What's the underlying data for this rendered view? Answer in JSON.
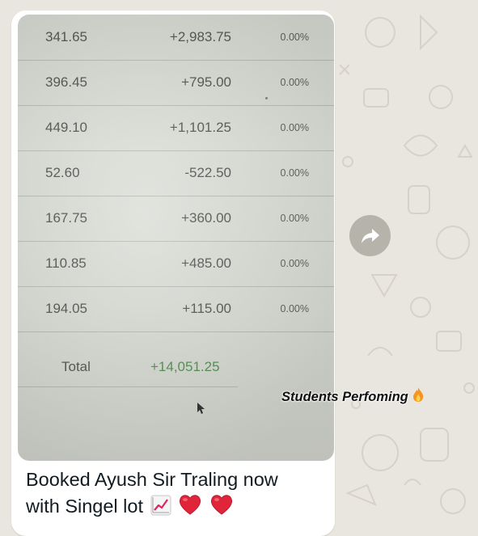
{
  "photo": {
    "rows": [
      {
        "price": "341.65",
        "pnl": "+2,983.75",
        "pct": "0.00%"
      },
      {
        "price": "396.45",
        "pnl": "+795.00",
        "pct": "0.00%"
      },
      {
        "price": "449.10",
        "pnl": "+1,101.25",
        "pct": "0.00%"
      },
      {
        "price": "52.60",
        "pnl": "-522.50",
        "pct": "0.00%"
      },
      {
        "price": "167.75",
        "pnl": "+360.00",
        "pct": "0.00%"
      },
      {
        "price": "110.85",
        "pnl": "+485.00",
        "pct": "0.00%"
      },
      {
        "price": "194.05",
        "pnl": "+115.00",
        "pct": "0.00%"
      }
    ],
    "total_label": "Total",
    "total_value": "+14,051.25"
  },
  "message": {
    "caption_line1": "Booked Ayush Sir Traling now",
    "caption_line2": "with Singel lot"
  },
  "sticker": {
    "text": "Students Perfoming"
  },
  "icons": {
    "forward": "forward-arrow-icon",
    "chart": "chart-increasing-emoji",
    "heart": "red-heart-emoji",
    "fire": "fire-emoji"
  },
  "colors": {
    "wallpaper": "#e9e6df",
    "bubble": "#ffffff",
    "positive_total": "#4e8a4b",
    "forward_button": "#8c8880"
  }
}
